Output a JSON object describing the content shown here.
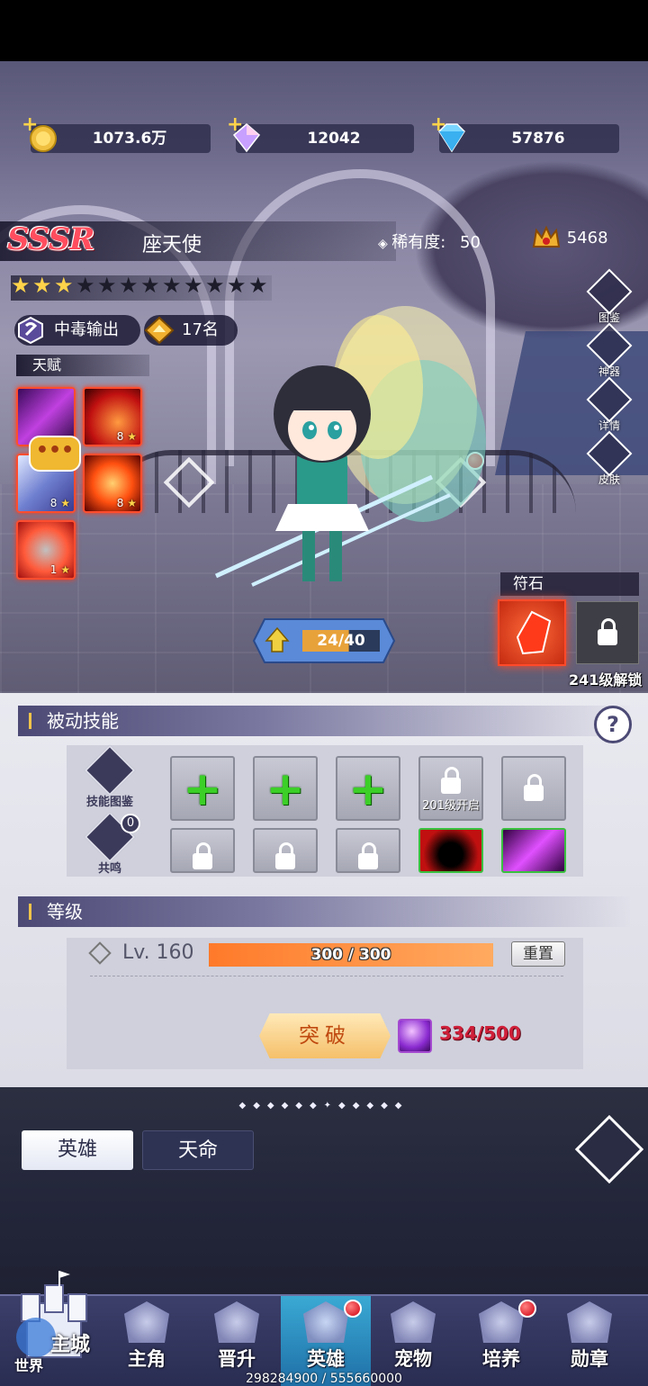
{
  "currency": {
    "gold": "1073.6万",
    "crystal": "12042",
    "diamond": "57876"
  },
  "hero": {
    "rarity_tier": "SSSR",
    "name": "座天使",
    "rarity_label": "稀有度:",
    "rarity_value": "50",
    "power": "5468",
    "stars_filled": 3,
    "stars_total": 12,
    "role": "中毒输出",
    "rank": "17名"
  },
  "talent": {
    "title": "天赋",
    "items": [
      {
        "level": ""
      },
      {
        "level": "8"
      },
      {
        "level": "8"
      },
      {
        "level": "8"
      },
      {
        "level": "1"
      }
    ]
  },
  "side_menu": [
    "图鉴",
    "神器",
    "详情",
    "皮肤"
  ],
  "exp": {
    "value": "24/40"
  },
  "rune": {
    "title": "符石",
    "locked_label": "241级解锁"
  },
  "passive": {
    "title": "被动技能",
    "help": "?",
    "codex_label": "技能图鉴",
    "resonance_label": "共鸣",
    "resonance_count": "0",
    "slot_unlock_label": "201级开启"
  },
  "level": {
    "title": "等级",
    "lv_label": "Lv. 160",
    "exp_text": "300 / 300",
    "exp_fraction": 1.0,
    "reset_label": "重置",
    "break_label": "突破",
    "break_cost": "334/500"
  },
  "tabs": [
    "英雄",
    "天命"
  ],
  "nav": {
    "items": [
      "主角",
      "晋升",
      "英雄",
      "宠物",
      "培养",
      "勋章"
    ],
    "active": "英雄",
    "home_label": "主城",
    "world_label": "世界",
    "hp_text": "298284900 / 555660000"
  },
  "colors": {
    "accent_orange": "#ff8a3d",
    "plus_green": "#3ccf28",
    "nav_active": "#2a8fc0",
    "sssr_red": "#ff4d5e"
  }
}
